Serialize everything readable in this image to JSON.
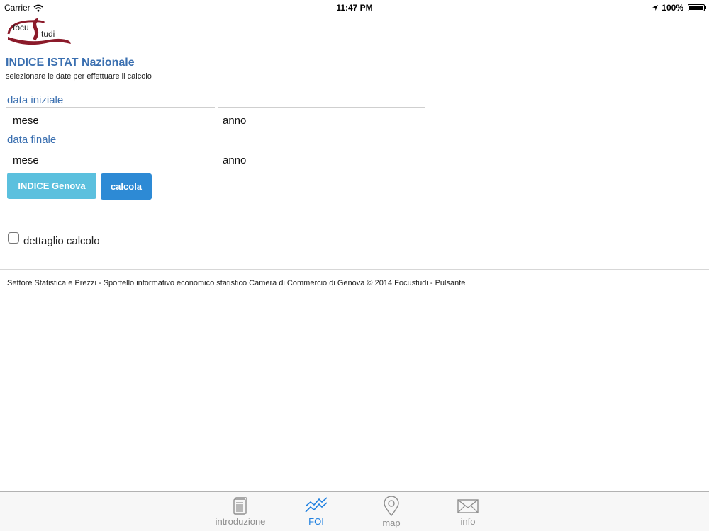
{
  "status_bar": {
    "carrier": "Carrier",
    "time": "11:47 PM",
    "battery": "100%",
    "battery_level": 1.0
  },
  "logo": {
    "text_top": "focu",
    "text_bottom": "tudi",
    "brand_color": "#8b1a2a"
  },
  "page": {
    "title": "INDICE ISTAT Nazionale",
    "subtitle": "selezionare le date per effettuare il calcolo"
  },
  "form": {
    "start": {
      "label": "data iniziale",
      "month_placeholder": "mese",
      "year_placeholder": "anno"
    },
    "end": {
      "label": "data finale",
      "month_placeholder": "mese",
      "year_placeholder": "anno"
    },
    "genova_button": "INDICE Genova",
    "calcola_button": "calcola",
    "detail_checkbox_label": "dettaglio calcolo",
    "detail_checked": false
  },
  "footer": {
    "text": "Settore Statistica e Prezzi - Sportello informativo economico statistico Camera di Commercio di Genova © 2014 Focustudi - Pulsante"
  },
  "tabbar": {
    "tabs": [
      {
        "label": "introduzione",
        "icon": "document-icon",
        "active": false
      },
      {
        "label": "FOI",
        "icon": "chart-line-icon",
        "active": true
      },
      {
        "label": "map",
        "icon": "map-pin-icon",
        "active": false
      },
      {
        "label": "info",
        "icon": "envelope-icon",
        "active": false
      }
    ]
  },
  "colors": {
    "accent": "#3a6fb0",
    "genova_button": "#5bc0de",
    "calcola_button": "#2d8ad5",
    "tab_active": "#1f80e0",
    "tab_inactive": "#8e8e8e"
  }
}
